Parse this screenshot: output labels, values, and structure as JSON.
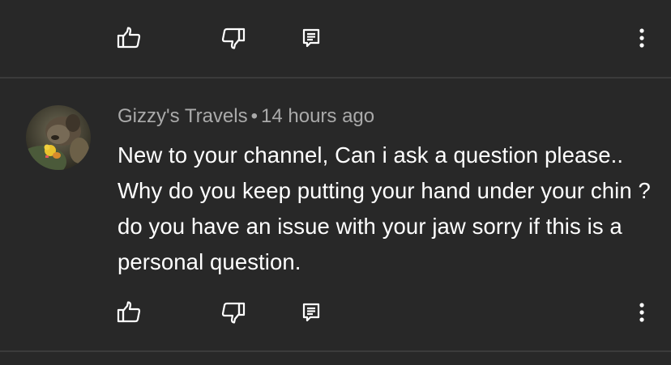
{
  "comment": {
    "author": "Gizzy's Travels",
    "separator": "•",
    "time": "14 hours ago",
    "text": "New to your channel, Can i ask a question please.. Why do you keep putting your hand under your chin ? do you have an issue with your jaw sorry if this is a personal question."
  },
  "icons": {
    "like": "thumbs-up-icon",
    "dislike": "thumbs-down-icon",
    "reply": "reply-comment-icon",
    "more": "more-vertical-icon"
  },
  "colors": {
    "background": "#282828",
    "divider": "#3b3b3b",
    "meta_text": "#aaaaaa",
    "body_text": "#ffffff"
  }
}
